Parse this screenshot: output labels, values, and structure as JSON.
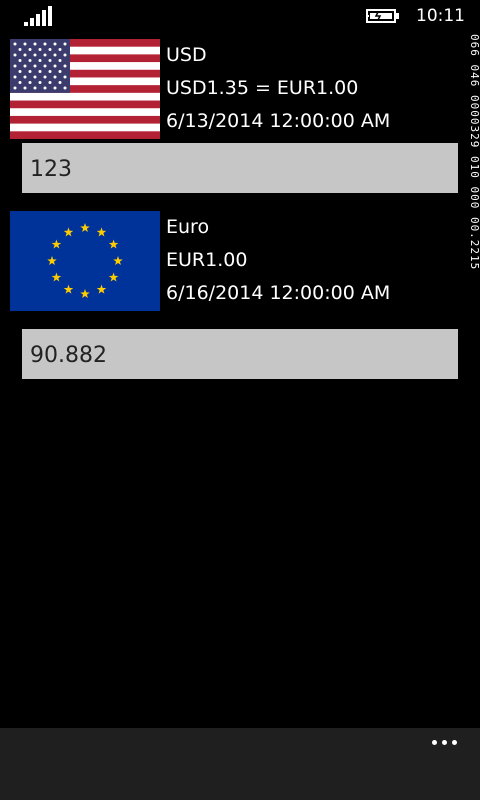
{
  "status_bar": {
    "time": "10:11",
    "signal_icon": "signal-strength-icon",
    "battery_icon": "battery-charging-icon"
  },
  "currencies": [
    {
      "code": "USD",
      "rate": "USD1.35 = EUR1.00",
      "date": "6/13/2014 12:00:00 AM",
      "amount": "123",
      "flag_icon": "us-flag-icon"
    },
    {
      "code": "Euro",
      "rate": "EUR1.00",
      "date": "6/16/2014 12:00:00 AM",
      "amount": "90.882",
      "flag_icon": "eu-flag-icon"
    }
  ],
  "debug_counter": "066 046 0000329 010 000 00.2215",
  "app_bar": {
    "more_icon": "ellipsis-icon"
  },
  "colors": {
    "background": "#000000",
    "input_background": "#c6c6c6",
    "app_bar": "#1f1f1f",
    "eu_blue": "#003399",
    "eu_star": "#ffcc00",
    "us_red": "#b22234",
    "us_blue": "#3c3b6e"
  }
}
